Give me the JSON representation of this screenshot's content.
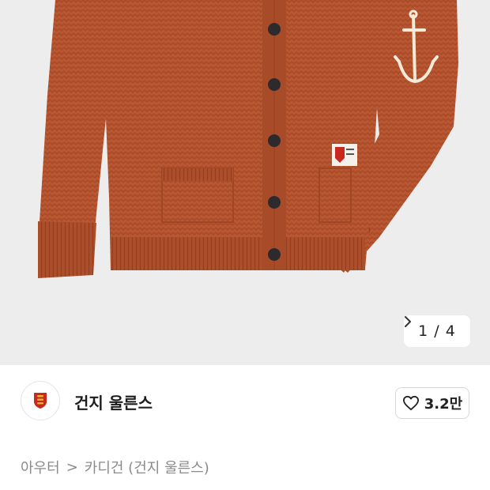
{
  "image": {
    "alt_icon": "cardigan-photo",
    "pager": {
      "count": "1 / 4",
      "next_icon": "chevron-right-icon"
    }
  },
  "brand": {
    "logo_icon": "guernsey-shield-icon",
    "name": "건지 울른스",
    "like_icon": "heart-outline-icon",
    "like_count": "3.2만"
  },
  "breadcrumb": {
    "items": [
      "아우터",
      "카디건 (건지 울른스)"
    ],
    "separator": ">"
  },
  "colors": {
    "sweater": "#b4532d",
    "image_bg": "#ededee",
    "accent_red": "#c8281e",
    "accent_yellow": "#e8b830"
  }
}
